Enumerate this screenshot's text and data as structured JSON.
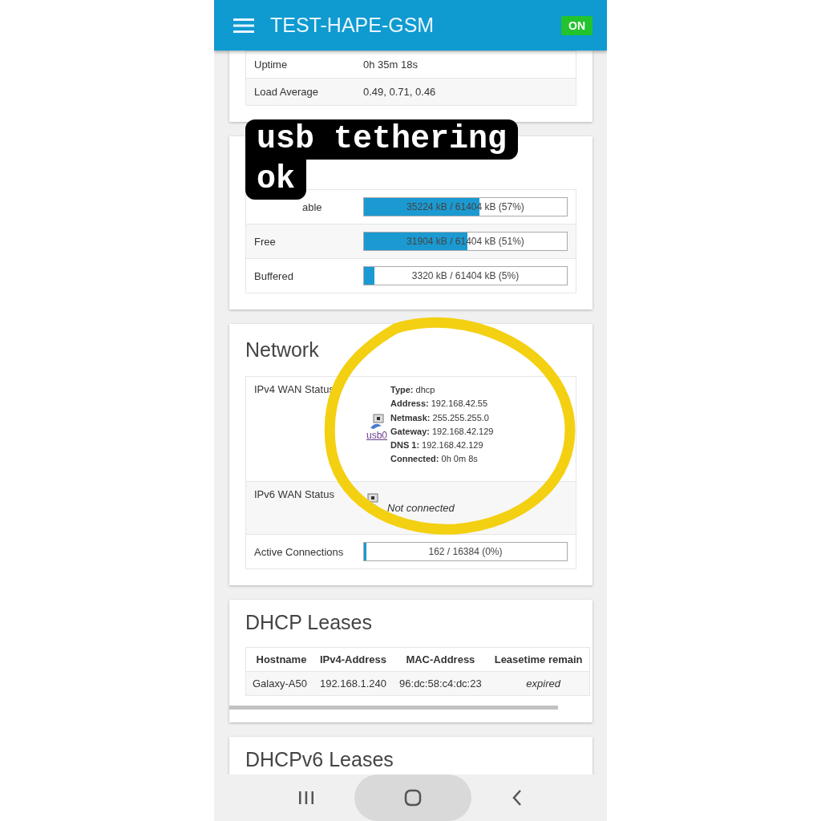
{
  "header": {
    "title": "TEST-HAPE-GSM",
    "badge": "ON"
  },
  "system": {
    "rows": [
      {
        "label": "Uptime",
        "value": "0h 35m 18s"
      },
      {
        "label": "Load Average",
        "value": "0.49, 0.71, 0.46"
      }
    ]
  },
  "memory": {
    "rows": [
      {
        "label": "able",
        "reading": "35224 kB / 61404 kB (57%)",
        "level": 0.57
      },
      {
        "label": "Free",
        "reading": "31904 kB / 61404 kB (51%)",
        "level": 0.51
      },
      {
        "label": "Buffered",
        "reading": "3320 kB / 61404 kB (5%)",
        "level": 0.05
      }
    ]
  },
  "sticker": {
    "lines": [
      "usb tethering",
      "ok"
    ]
  },
  "network": {
    "title": "Network",
    "ipv4": {
      "label": "IPv4 WAN Status",
      "interface": "usb0",
      "details": [
        {
          "key": "Type:",
          "value": "dhcp"
        },
        {
          "key": "Address:",
          "value": "192.168.42.55"
        },
        {
          "key": "Netmask:",
          "value": "255.255.255.0"
        },
        {
          "key": "Gateway:",
          "value": "192.168.42.129"
        },
        {
          "key": "DNS 1:",
          "value": "192.168.42.129"
        },
        {
          "key": "Connected:",
          "value": "0h 0m 8s"
        }
      ]
    },
    "ipv6": {
      "label": "IPv6 WAN Status",
      "status": "Not connected"
    },
    "connections": {
      "label": "Active Connections",
      "reading": "162 / 16384 (0%)",
      "level": 0.01
    }
  },
  "dhcp": {
    "title": "DHCP Leases",
    "columns": [
      "Hostname",
      "IPv4-Address",
      "MAC-Address",
      "Leasetime remain"
    ],
    "rows": [
      [
        "Galaxy-A50",
        "192.168.1.240",
        "96:dc:58:c4:dc:23",
        "expired"
      ]
    ]
  },
  "dhcpv6": {
    "title": "DHCPv6 Leases"
  }
}
